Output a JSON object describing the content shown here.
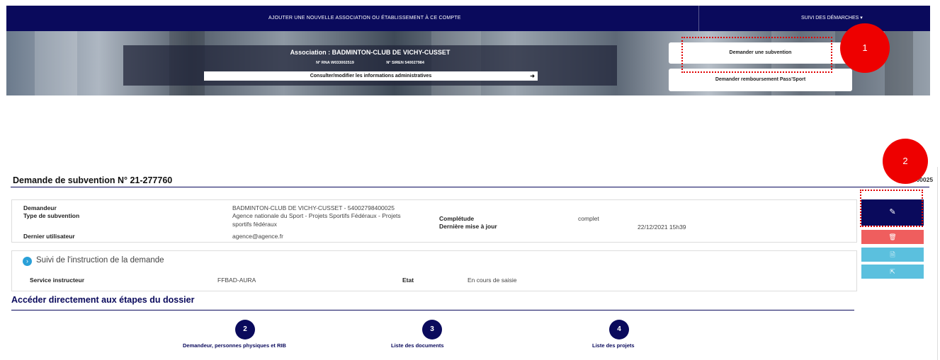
{
  "nav": {
    "add_association": "AJOUTER UNE NOUVELLE ASSOCIATION OU ÉTABLISSEMENT À CE COMPTE",
    "suivi_demarches": "SUIVI DES DÉMARCHES",
    "caret": "▾"
  },
  "banner": {
    "association_title": "Association : BADMINTON-CLUB DE VICHY-CUSSET",
    "rna": "N° RNA W033002519",
    "siren": "N° SIREN 540027984",
    "consult_button": "Consulter/modifier les informations administratives",
    "consult_arrow": "➜",
    "btn_subvention": "Demander une subvention",
    "btn_passsport": "Demander remboursement Pass'Sport"
  },
  "annotations": {
    "badge1": "1",
    "badge2": "2"
  },
  "request": {
    "title": "Demande de subvention N° 21-277760",
    "right_code": "5400025",
    "labels": {
      "demandeur": "Demandeur",
      "type": "Type de subvention",
      "dernier_utilisateur": "Dernier utilisateur",
      "completude": "Complétude",
      "derniere_maj": "Dernière mise à jour"
    },
    "values": {
      "demandeur": "BADMINTON-CLUB DE VICHY-CUSSET - 54002798400025",
      "type_line1": "Agence nationale du Sport - Projets Sportifs Fédéraux - Projets",
      "type_line2": "sportifs fédéraux",
      "dernier_utilisateur": "agence@agence.fr",
      "completude": "complet",
      "derniere_maj": "22/12/2021 15h39"
    }
  },
  "suivi": {
    "title": "Suivi de l'instruction de la demande",
    "icon": "›",
    "service_label": "Service instructeur",
    "service_value": "FFBAD-AURA",
    "etat_label": "Etat",
    "etat_value": "En cours de saisie"
  },
  "actions": {
    "edit_icon": "✎",
    "delete_icon": "🗑",
    "doc_icon": "🗎",
    "export_icon": "⇱"
  },
  "steps": {
    "title": "Accéder directement aux étapes du dossier",
    "items": [
      {
        "number": "2",
        "label": "Demandeur, personnes physiques et RIB"
      },
      {
        "number": "3",
        "label": "Liste des documents"
      },
      {
        "number": "4",
        "label": "Liste des projets"
      }
    ]
  },
  "colors": {
    "navy": "#0a0a5c",
    "danger": "#ef5e5e",
    "info": "#5bc0de",
    "annotation_red": "#ee0000"
  }
}
